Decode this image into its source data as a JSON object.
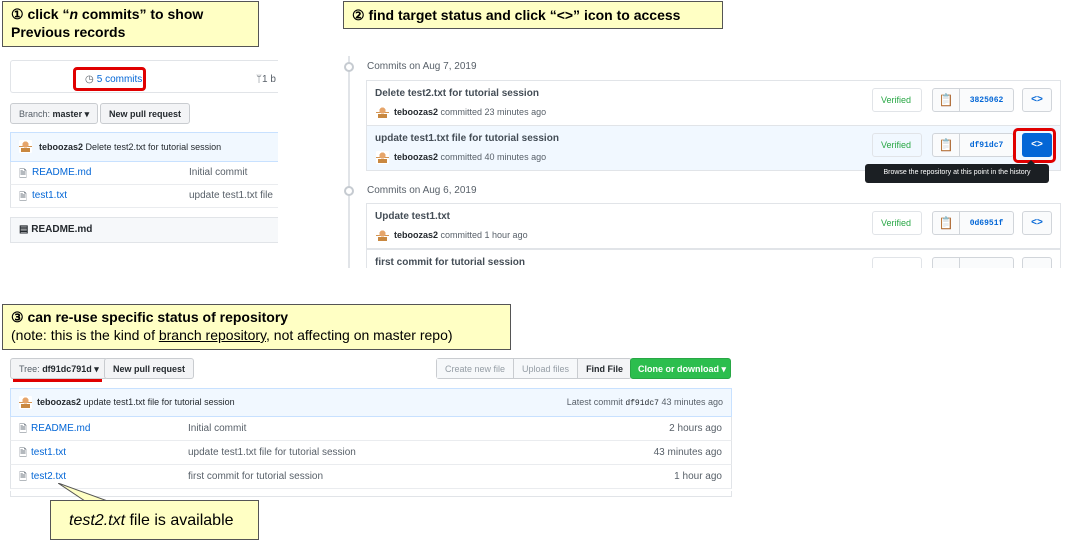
{
  "callouts": {
    "step1_line1_pre": "① click “",
    "step1_line1_em": "n",
    "step1_line1_post": " commits” to show",
    "step1_line2": "Previous records",
    "step2": "② find target status and click “<>” icon to access",
    "step3_title": "③ can re-use specific status of repository",
    "step3_note_pre": "(note: this is the kind of ",
    "step3_note_u": "branch repository",
    "step3_note_post": ",  not affecting on master repo)",
    "step4_em": "test2.txt",
    "step4_post": " file is available"
  },
  "panel1": {
    "commits_label": "5 commits",
    "branches_label": "1 b",
    "branch_prefix": "Branch:",
    "branch_name": "master",
    "new_pr": "New pull request",
    "latest_author": "teboozas2",
    "latest_msg": "Delete test2.txt for tutorial session",
    "files": [
      {
        "name": "README.md",
        "msg": "Initial commit"
      },
      {
        "name": "test1.txt",
        "msg": "update test1.txt file"
      }
    ],
    "readme_header": "README.md"
  },
  "panel2": {
    "groups": [
      {
        "date": "Commits on Aug 7, 2019"
      },
      {
        "date": "Commits on Aug 6, 2019"
      }
    ],
    "commits": [
      {
        "msg": "Delete test2.txt for tutorial session",
        "author": "teboozas2",
        "when": "committed 23 minutes ago",
        "verified": "Verified",
        "sha": "3825062"
      },
      {
        "msg": "update test1.txt file for tutorial session",
        "author": "teboozas2",
        "when": "committed 40 minutes ago",
        "verified": "Verified",
        "sha": "df91dc7"
      },
      {
        "msg": "Update test1.txt",
        "author": "teboozas2",
        "when": "committed 1 hour ago",
        "verified": "Verified",
        "sha": "0d6951f"
      },
      {
        "msg": "first commit for tutorial session",
        "author": "",
        "when": "",
        "verified": "",
        "sha": ""
      }
    ],
    "browse_glyph": "<>",
    "tooltip": "Browse the repository at this point in the history"
  },
  "panel3": {
    "tree_prefix": "Tree:",
    "tree_sha": "df91dc791d",
    "new_pr": "New pull request",
    "create_file": "Create new file",
    "upload_files": "Upload files",
    "find_file": "Find File",
    "clone": "Clone or download",
    "latest_author": "teboozas2",
    "latest_msg": "update test1.txt file for tutorial session",
    "latest_prefix": "Latest commit",
    "latest_sha": "df91dc7",
    "latest_when": "43 minutes ago",
    "files": [
      {
        "name": "README.md",
        "msg": "Initial commit",
        "age": "2 hours ago"
      },
      {
        "name": "test1.txt",
        "msg": "update test1.txt file for tutorial session",
        "age": "43 minutes ago"
      },
      {
        "name": "test2.txt",
        "msg": "first commit for tutorial session",
        "age": "1 hour ago"
      }
    ]
  },
  "colors": {
    "callout_bg": "#ffffc4",
    "highlight_red": "#e00000",
    "link_blue": "#0366d6",
    "verified_green": "#28a745",
    "clone_green": "#2cbe4e"
  }
}
